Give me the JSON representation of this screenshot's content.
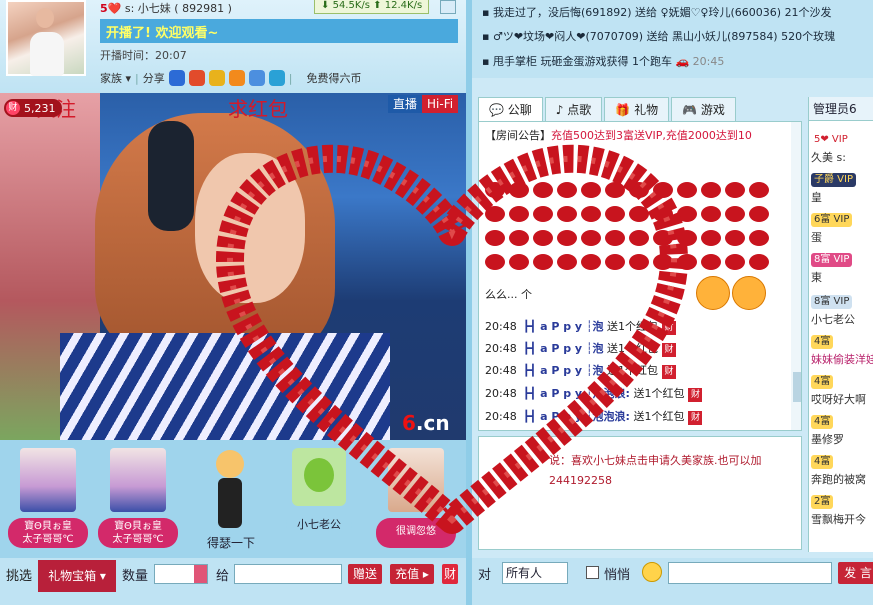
{
  "host": {
    "level_hearts": "5❤️",
    "name_line": "s: 小七妹 ( 892981 )",
    "speed_down": "54.5K/s",
    "speed_up": "12.4K/s",
    "announcement": "开播了! 欢迎观看~",
    "start_time": "开播时间：20:07",
    "family_label": "家族 ▾",
    "share_label": "分享",
    "free_coins": "免费得六币"
  },
  "video": {
    "counter": "5,231",
    "counter_icon": "财",
    "overlay_follow": "关注",
    "overlay_redpack": "求红包",
    "live_label": "直播",
    "hifi_label": "Hi-Fi",
    "logo_six": "6",
    "logo_cn": ".cn"
  },
  "gifts": [
    {
      "label_line1": "寶Θ貝ぉ皇",
      "label_line2": "太子哥哥℃"
    },
    {
      "label_line1": "寶Θ貝ぉ皇",
      "label_line2": "太子哥哥℃"
    }
  ],
  "guest_figure_label": "得瑟一下",
  "alien_label": "小七老公",
  "pink_card_label": "很调忽悠",
  "gift_bar": {
    "pick_label": "挑选",
    "gift_box_label": "礼物宝箱 ▾",
    "qty_label": "数量",
    "to_label": "给",
    "send_label": "赠送",
    "recharge_label": "充值 ▸",
    "coin_label": "财"
  },
  "ticker": [
    {
      "text": "▪ 我走过了，没后悔(691892) 送给 ♀妩媚♡♀玲儿(660036) 21个沙发"
    },
    {
      "text": "▪ ♂ツ❤坟场❤闷人❤(7070709) 送给 黑山小妖儿(897584) 520个玫瑰"
    },
    {
      "text": "▪ 甩手掌柜 玩砸金蛋游戏获得 1个跑车",
      "time": "20:45"
    }
  ],
  "tabs": [
    "公聊",
    "点歌",
    "礼物",
    "游戏"
  ],
  "chat": {
    "notice_tag": "【房间公告】",
    "notice": "充值500达到3富送VIP,充值2000达到10",
    "heart_text": "么么...",
    "heart_text2": "个",
    "lines": [
      {
        "time": "20:48",
        "name": "┣┫ a P p y ┆泡",
        "msg": "送1个红包",
        "pk": "财"
      },
      {
        "time": "20:48",
        "name": "┣┫ a P p y ┆泡",
        "msg": "送1个红包",
        "pk": "财"
      },
      {
        "time": "20:48",
        "name": "┣┫ a P p y ┆泡",
        "msg": "送1个红包",
        "pk": "财"
      },
      {
        "time": "20:48",
        "name": "┣┫ a P p y ┆泡泡浪:",
        "msg": "送1个红包",
        "pk": "财"
      },
      {
        "time": "20:48",
        "name": "┣┫ a P p y ┆泡泡浪:",
        "msg": "送1个红包",
        "pk": "财"
      }
    ]
  },
  "private_chat": {
    "say": "说：喜欢小七妹点击申请久美家族.也可以加",
    "number": "244192258"
  },
  "userlist": {
    "tab": "管理员6",
    "users": [
      {
        "badge": "5❤ VIP",
        "name": "久美 s:"
      },
      {
        "badge": "子爵 VIP",
        "name": "皇"
      },
      {
        "badge": "6富 VIP",
        "name": "蛋"
      },
      {
        "badge": "8富 VIP",
        "name": "東"
      },
      {
        "badge": "8富 VIP",
        "name": "小七老公"
      },
      {
        "badge": "4富",
        "name": "妹妹偷装洋娃"
      },
      {
        "badge": "4富",
        "name": "哎呀好大啊"
      },
      {
        "badge": "4富",
        "name": "墨修罗"
      },
      {
        "badge": "4富",
        "name": "奔跑的被窝"
      },
      {
        "badge": "2富",
        "name": "雪飘梅开今"
      }
    ]
  },
  "chat_input": {
    "to_label": "对",
    "target": "所有人",
    "whisper_label": "悄悄",
    "send_label": "发 言"
  },
  "colors": {
    "accent_red": "#c8141e",
    "panel_blue": "#bfe3f3"
  }
}
